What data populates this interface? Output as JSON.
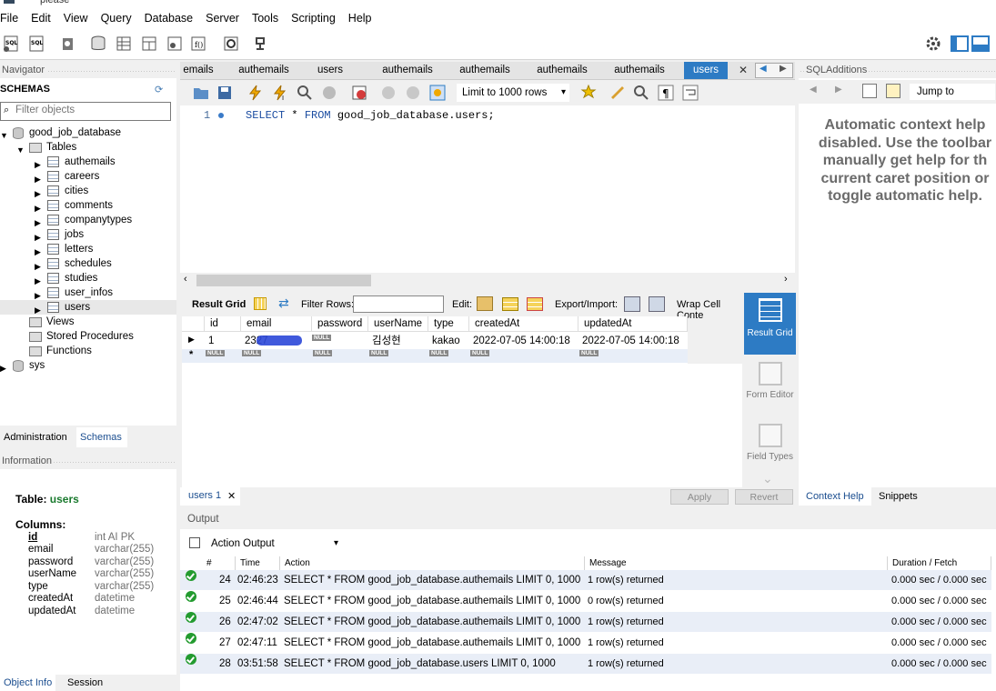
{
  "window": {
    "title": "please"
  },
  "menu": [
    "File",
    "Edit",
    "View",
    "Query",
    "Database",
    "Server",
    "Tools",
    "Scripting",
    "Help"
  ],
  "navigator": {
    "header": "Navigator",
    "schemas_label": "SCHEMAS",
    "filter_placeholder": "Filter objects",
    "database": "good_job_database",
    "tables_label": "Tables",
    "tables": [
      "authemails",
      "careers",
      "cities",
      "comments",
      "companytypes",
      "jobs",
      "letters",
      "schedules",
      "studies",
      "user_infos",
      "users"
    ],
    "views_label": "Views",
    "procedures_label": "Stored Procedures",
    "functions_label": "Functions",
    "sys_label": "sys",
    "tab_admin": "Administration",
    "tab_schemas": "Schemas"
  },
  "info": {
    "header": "Information",
    "table_prefix": "Table:",
    "table_name": "users",
    "columns_label": "Columns:",
    "columns": [
      {
        "name": "id",
        "type": "int AI PK"
      },
      {
        "name": "email",
        "type": "varchar(255)"
      },
      {
        "name": "password",
        "type": "varchar(255)"
      },
      {
        "name": "userName",
        "type": "varchar(255)"
      },
      {
        "name": "type",
        "type": "varchar(255)"
      },
      {
        "name": "createdAt",
        "type": "datetime"
      },
      {
        "name": "updatedAt",
        "type": "datetime"
      }
    ],
    "tab_object": "Object Info",
    "tab_session": "Session"
  },
  "editor": {
    "tabs": [
      "emails",
      "authemails",
      "users",
      "authemails",
      "authemails",
      "authemails",
      "authemails",
      "users"
    ],
    "limit": "Limit to 1000 rows",
    "line_number": "1",
    "query_keyword1": "SELECT",
    "query_mid": " * ",
    "query_keyword2": "FROM",
    "query_rest": " good_job_database.users;"
  },
  "result": {
    "grid_label": "Result Grid",
    "filter_label": "Filter Rows:",
    "edit_label": "Edit:",
    "export_label": "Export/Import:",
    "wrap_label": "Wrap Cell Conte",
    "columns": [
      "id",
      "email",
      "password",
      "userName",
      "type",
      "createdAt",
      "updatedAt"
    ],
    "row": {
      "id": "1",
      "email": "2327",
      "userName": "김성현",
      "type": "kakao",
      "createdAt": "2022-07-05 14:00:18",
      "updatedAt": "2022-07-05 14:00:18"
    },
    "null_text": "NULL",
    "side_result": "Result Grid",
    "side_form": "Form Editor",
    "side_field": "Field Types",
    "bottom_tab": "users 1",
    "apply": "Apply",
    "revert": "Revert"
  },
  "sqladditions": {
    "header": "SQLAdditions",
    "jump_to": "Jump to",
    "help_lines": [
      "Automatic context help",
      "disabled. Use the toolbar",
      "manually get help for th",
      "current caret position or",
      "toggle automatic help."
    ],
    "tab_context": "Context Help",
    "tab_snippets": "Snippets"
  },
  "output": {
    "header": "Output",
    "select": "Action Output",
    "columns": [
      "#",
      "Time",
      "Action",
      "Message",
      "Duration / Fetch"
    ],
    "rows": [
      {
        "num": "24",
        "time": "02:46:23",
        "action": "SELECT * FROM good_job_database.authemails LIMIT 0, 1000",
        "message": "1 row(s) returned",
        "duration": "0.000 sec / 0.000 sec"
      },
      {
        "num": "25",
        "time": "02:46:44",
        "action": "SELECT * FROM good_job_database.authemails LIMIT 0, 1000",
        "message": "0 row(s) returned",
        "duration": "0.000 sec / 0.000 sec"
      },
      {
        "num": "26",
        "time": "02:47:02",
        "action": "SELECT * FROM good_job_database.authemails LIMIT 0, 1000",
        "message": "1 row(s) returned",
        "duration": "0.000 sec / 0.000 sec"
      },
      {
        "num": "27",
        "time": "02:47:11",
        "action": "SELECT * FROM good_job_database.authemails LIMIT 0, 1000",
        "message": "1 row(s) returned",
        "duration": "0.000 sec / 0.000 sec"
      },
      {
        "num": "28",
        "time": "03:51:58",
        "action": "SELECT * FROM good_job_database.users LIMIT 0, 1000",
        "message": "1 row(s) returned",
        "duration": "0.000 sec / 0.000 sec"
      }
    ]
  }
}
